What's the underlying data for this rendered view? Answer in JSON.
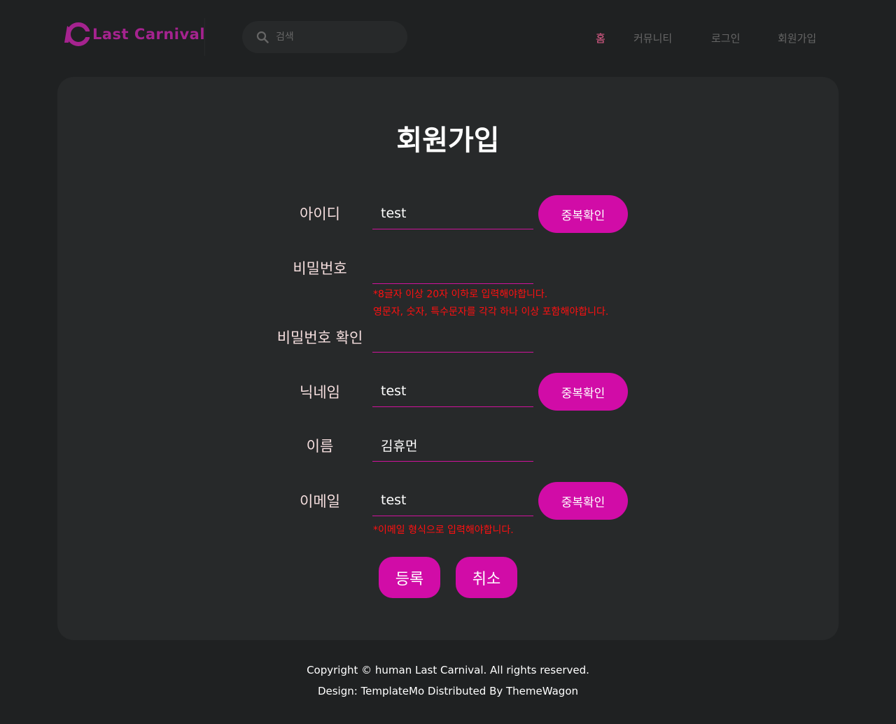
{
  "header": {
    "logo_text": "Last Carnival",
    "search": {
      "placeholder": "검색"
    },
    "nav": [
      {
        "label": "홈",
        "active": true
      },
      {
        "label": "커뮤니티",
        "active": false
      },
      {
        "label": "로그인",
        "active": false
      },
      {
        "label": "회원가입",
        "active": false
      }
    ]
  },
  "form": {
    "title": "회원가입",
    "id": {
      "label": "아이디",
      "value": "test",
      "button": "중복확인"
    },
    "password": {
      "label": "비밀번호",
      "value": "",
      "warning_line1": "*8글자 이상 20자 이하로 입력해야합니다.",
      "warning_line2": "영문자, 숫자, 특수문자를 각각 하나 이상 포함해야합니다."
    },
    "password_confirm": {
      "label": "비밀번호 확인",
      "value": ""
    },
    "nickname": {
      "label": "닉네임",
      "value": "test",
      "button": "중복확인"
    },
    "name": {
      "label": "이름",
      "value": "김휴먼"
    },
    "email": {
      "label": "이메일",
      "value": "test",
      "button": "중복확인",
      "warning": "*이메일 형식으로 입력해야합니다."
    },
    "submit_label": "등록",
    "cancel_label": "취소"
  },
  "footer": {
    "copyright": "Copyright © human Last Carnival. All rights reserved.",
    "design": "Design: TemplateMo Distributed By ThemeWagon"
  },
  "colors": {
    "background": "#1f2122",
    "card": "#27292a",
    "accent": "#d10ca7",
    "nav_active": "#e75e8d",
    "warning": "#ff1010",
    "logo": "#a5238f"
  }
}
